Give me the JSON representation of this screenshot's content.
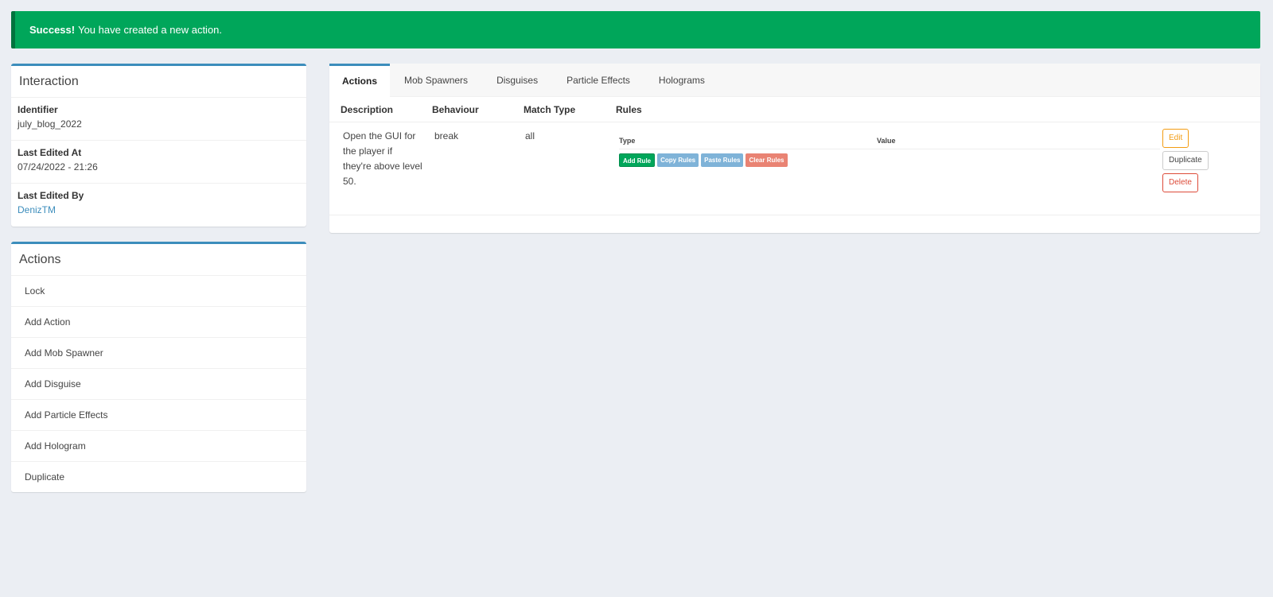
{
  "alert": {
    "bold": "Success!",
    "message": "You have created a new action."
  },
  "interaction": {
    "title": "Interaction",
    "fields": [
      {
        "label": "Identifier",
        "value": "july_blog_2022"
      },
      {
        "label": "Last Edited At",
        "value": "07/24/2022 - 21:26"
      },
      {
        "label": "Last Edited By",
        "value": "DenizTM"
      }
    ]
  },
  "actions_panel": {
    "title": "Actions",
    "items": [
      "Lock",
      "Add Action",
      "Add Mob Spawner",
      "Add Disguise",
      "Add Particle Effects",
      "Add Hologram",
      "Duplicate"
    ]
  },
  "tabs": [
    "Actions",
    "Mob Spawners",
    "Disguises",
    "Particle Effects",
    "Holograms"
  ],
  "table": {
    "headers": [
      "Description",
      "Behaviour",
      "Match Type",
      "Rules"
    ],
    "row": {
      "description": "Open the GUI for the player if they're above level 50.",
      "behaviour": "break",
      "match_type": "all",
      "rules_headers": [
        "Type",
        "Value"
      ],
      "rule_buttons": [
        "Add Rule",
        "Copy Rules",
        "Paste Rules",
        "Clear Rules"
      ],
      "row_buttons": [
        "Edit",
        "Duplicate",
        "Delete"
      ]
    }
  },
  "colors": {
    "success": "#00a65a",
    "primary": "#3c8dbc",
    "warning": "#f39c12",
    "danger": "#dd4b39"
  }
}
